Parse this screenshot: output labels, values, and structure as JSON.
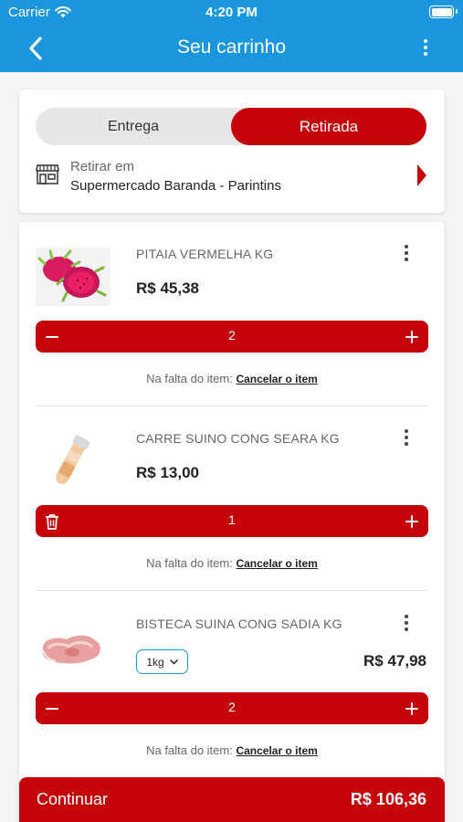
{
  "status_bar": {
    "carrier": "Carrier",
    "time": "4:20 PM"
  },
  "header": {
    "title": "Seu carrinho"
  },
  "delivery": {
    "options": [
      "Entrega",
      "Retirada"
    ],
    "selected": "Retirada",
    "pickup_label": "Retirar em",
    "pickup_store": "Supermercado Baranda - Parintins"
  },
  "items": [
    {
      "name": "PITAIA VERMELHA KG",
      "price": "R$ 45,38",
      "quantity": "2",
      "decrement_icon": "minus-icon"
    },
    {
      "name": "CARRE SUINO CONG SEARA KG",
      "price": "R$ 13,00",
      "quantity": "1",
      "decrement_icon": "trash-icon"
    },
    {
      "name": "BISTECA SUINA CONG SADIA KG",
      "price": "R$ 47,98",
      "quantity": "2",
      "unit": "1kg",
      "decrement_icon": "minus-icon"
    }
  ],
  "missing_text": "Na falta do item:",
  "missing_action": "Cancelar o item",
  "footer": {
    "continue_label": "Continuar",
    "total": "R$ 106,36"
  },
  "colors": {
    "header": "#1a96de",
    "accent": "#c50409",
    "background": "#f4f4f6"
  }
}
